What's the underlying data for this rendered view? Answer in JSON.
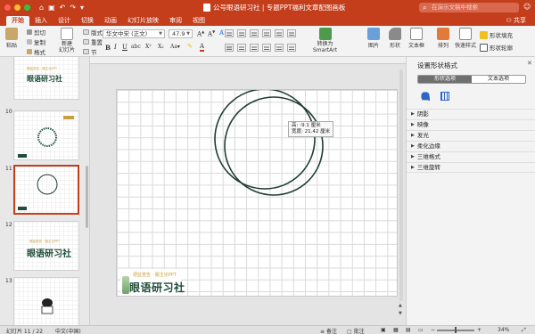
{
  "titlebar": {
    "title": "公号眼语研习社 | 专题PPT福利文章配图画板",
    "search_placeholder": "在演示文稿中搜索"
  },
  "tabs": [
    "开始",
    "插入",
    "设计",
    "切换",
    "动画",
    "幻灯片放映",
    "审阅",
    "视图"
  ],
  "share_label": "共享",
  "ribbon": {
    "paste": "粘贴",
    "cut": "剪切",
    "copy": "复制",
    "format": "格式",
    "new_slide": "新建\n幻灯片",
    "layout": "版式",
    "reset": "重置",
    "section": "节",
    "font_name": "华文中宋 (正文)",
    "font_size": "47.9",
    "convert_smartart": "转换为\nSmartArt",
    "picture": "图片",
    "shape": "形状",
    "textbox": "文本框",
    "arrange": "排列",
    "quick_styles": "快速样式",
    "shape_fill": "形状填充",
    "shape_outline": "形状轮廓"
  },
  "thumbnails": [
    {
      "num": "",
      "logo_tag": "便监查告 · 服主论PPT",
      "logo_name": "眼语研习社"
    },
    {
      "num": "10"
    },
    {
      "num": "11"
    },
    {
      "num": "12",
      "logo_tag": "便监查告 · 服主论PPT",
      "logo_name": "眼语研习社"
    },
    {
      "num": "13"
    }
  ],
  "tooltip": {
    "line1": "高: -9.1 厘米",
    "line2": "宽度: 21.42 厘米"
  },
  "slide_logo": {
    "tag": "便监查告 · 服主论PPT",
    "name": "眼语研习社"
  },
  "pane": {
    "title": "设置形状格式",
    "tab_shape": "形状选项",
    "tab_text": "文本选项",
    "items": [
      "阴影",
      "映像",
      "发光",
      "柔化边缘",
      "三维格式",
      "三维旋转"
    ]
  },
  "status": {
    "slide_info": "幻灯片 11 / 22",
    "language": "中文(中国)",
    "notes": "备注",
    "comments": "批注",
    "zoom": "34%"
  },
  "colors": {
    "accent": "#c43e1c",
    "circle_stroke": "#1f3d30"
  }
}
